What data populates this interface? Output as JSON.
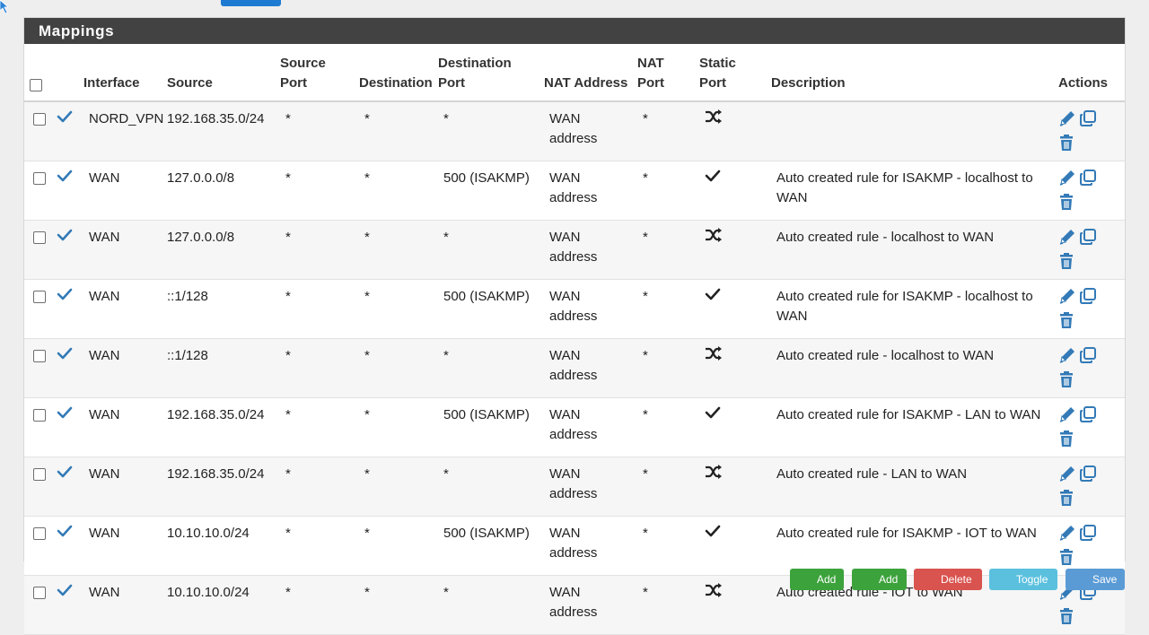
{
  "panel": {
    "title": "Mappings"
  },
  "columns": {
    "interface": "Interface",
    "source": "Source",
    "source_port": [
      "Source",
      "Port"
    ],
    "destination": "Destination",
    "destination_port": [
      "Destination",
      "Port"
    ],
    "nat_address": "NAT Address",
    "nat_port": [
      "NAT",
      "Port"
    ],
    "static_port": [
      "Static",
      "Port"
    ],
    "description": "Description",
    "actions": "Actions"
  },
  "rows": [
    {
      "interface": "NORD_VPN",
      "source": "192.168.35.0/24",
      "source_port": "*",
      "destination": "*",
      "destination_port": "*",
      "nat_address": [
        "WAN",
        "address"
      ],
      "nat_port": "*",
      "static_port": "shuffle-icon",
      "description": ""
    },
    {
      "interface": "WAN",
      "source": "127.0.0.0/8",
      "source_port": "*",
      "destination": "*",
      "destination_port": "500 (ISAKMP)",
      "nat_address": [
        "WAN",
        "address"
      ],
      "nat_port": "*",
      "static_port": "check-icon",
      "description": [
        "Auto created rule for ISAKMP - localhost to",
        "WAN"
      ]
    },
    {
      "interface": "WAN",
      "source": "127.0.0.0/8",
      "source_port": "*",
      "destination": "*",
      "destination_port": "*",
      "nat_address": [
        "WAN",
        "address"
      ],
      "nat_port": "*",
      "static_port": "shuffle-icon",
      "description": "Auto created rule - localhost to WAN"
    },
    {
      "interface": "WAN",
      "source": "::1/128",
      "source_port": "*",
      "destination": "*",
      "destination_port": "500 (ISAKMP)",
      "nat_address": [
        "WAN",
        "address"
      ],
      "nat_port": "*",
      "static_port": "check-icon",
      "description": [
        "Auto created rule for ISAKMP - localhost to",
        "WAN"
      ]
    },
    {
      "interface": "WAN",
      "source": "::1/128",
      "source_port": "*",
      "destination": "*",
      "destination_port": "*",
      "nat_address": [
        "WAN",
        "address"
      ],
      "nat_port": "*",
      "static_port": "shuffle-icon",
      "description": "Auto created rule - localhost to WAN"
    },
    {
      "interface": "WAN",
      "source": "192.168.35.0/24",
      "source_port": "*",
      "destination": "*",
      "destination_port": "500 (ISAKMP)",
      "nat_address": [
        "WAN",
        "address"
      ],
      "nat_port": "*",
      "static_port": "check-icon",
      "description": "Auto created rule for ISAKMP - LAN to WAN"
    },
    {
      "interface": "WAN",
      "source": "192.168.35.0/24",
      "source_port": "*",
      "destination": "*",
      "destination_port": "*",
      "nat_address": [
        "WAN",
        "address"
      ],
      "nat_port": "*",
      "static_port": "shuffle-icon",
      "description": "Auto created rule - LAN to WAN"
    },
    {
      "interface": "WAN",
      "source": "10.10.10.0/24",
      "source_port": "*",
      "destination": "*",
      "destination_port": "500 (ISAKMP)",
      "nat_address": [
        "WAN",
        "address"
      ],
      "nat_port": "*",
      "static_port": "check-icon",
      "description": "Auto created rule for ISAKMP - IOT to WAN"
    },
    {
      "interface": "WAN",
      "source": "10.10.10.0/24",
      "source_port": "*",
      "destination": "*",
      "destination_port": "*",
      "nat_address": [
        "WAN",
        "address"
      ],
      "nat_port": "*",
      "static_port": "shuffle-icon",
      "description": "Auto created rule - IOT to WAN"
    }
  ],
  "colors": {
    "heading_bg": "#424242",
    "icon_blue": "#337ab7",
    "btn_add": "#3ca23c",
    "btn_delete": "#d9534f",
    "btn_toggle": "#5bc0de",
    "btn_save": "#5b9bd5"
  },
  "buttons": {
    "add_top": "Add",
    "add_bottom": "Add",
    "delete": "Delete",
    "toggle": "Toggle",
    "save": "Save"
  }
}
